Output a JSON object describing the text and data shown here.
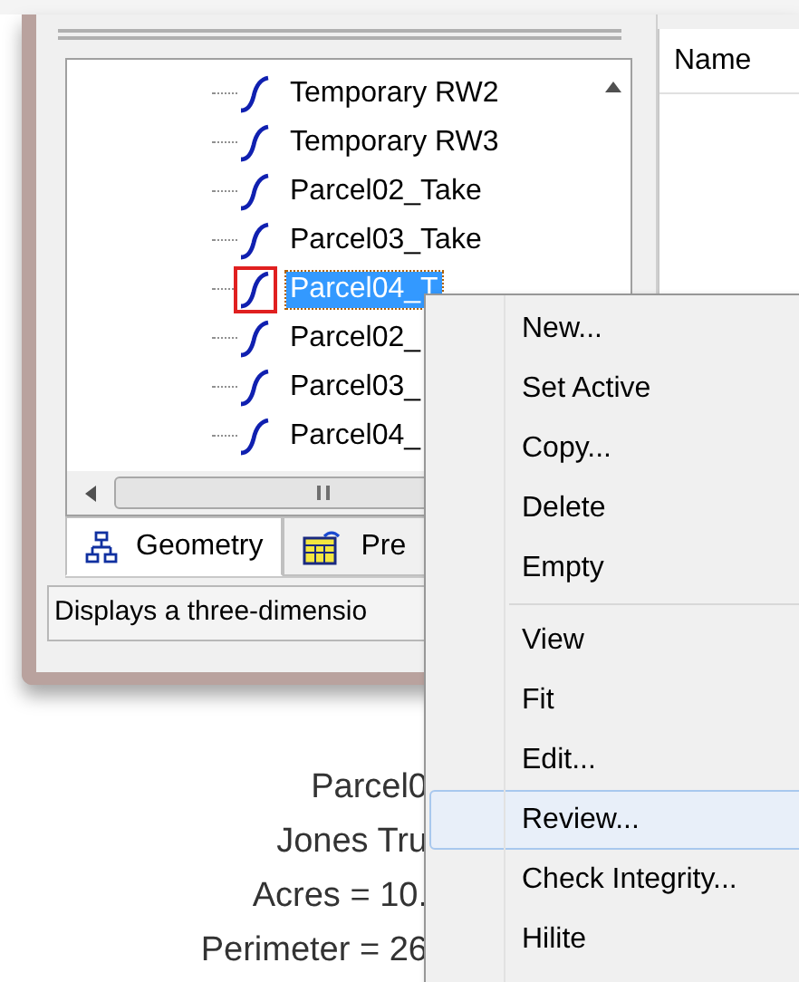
{
  "right_panel": {
    "column_header": "Name"
  },
  "tree": {
    "items": [
      {
        "label": "Temporary RW2",
        "selected": false
      },
      {
        "label": "Temporary RW3",
        "selected": false
      },
      {
        "label": "Parcel02_Take",
        "selected": false
      },
      {
        "label": "Parcel03_Take",
        "selected": false
      },
      {
        "label": "Parcel04_T",
        "selected": true
      },
      {
        "label": "Parcel02_",
        "selected": false
      },
      {
        "label": "Parcel03_",
        "selected": false
      },
      {
        "label": "Parcel04_",
        "selected": false
      }
    ]
  },
  "tabs": [
    {
      "label": "Geometry",
      "selected": true,
      "kind": "geometry"
    },
    {
      "label": "Pre",
      "selected": false,
      "kind": "table"
    }
  ],
  "status_bar": "Displays a three-dimensio",
  "document_lines": [
    "Parcel0",
    "Jones Tru",
    "Acres = 10.",
    "Perimeter = 26"
  ],
  "context_menu": {
    "items": [
      {
        "kind": "item",
        "label": "New...",
        "hovered": false
      },
      {
        "kind": "item",
        "label": "Set Active",
        "hovered": false
      },
      {
        "kind": "item",
        "label": "Copy...",
        "hovered": false
      },
      {
        "kind": "item",
        "label": "Delete",
        "hovered": false
      },
      {
        "kind": "item",
        "label": "Empty",
        "hovered": false
      },
      {
        "kind": "separator"
      },
      {
        "kind": "item",
        "label": "View",
        "hovered": false
      },
      {
        "kind": "item",
        "label": "Fit",
        "hovered": false
      },
      {
        "kind": "item",
        "label": "Edit...",
        "hovered": false
      },
      {
        "kind": "item",
        "label": "Review...",
        "hovered": true
      },
      {
        "kind": "item",
        "label": "Check Integrity...",
        "hovered": false
      },
      {
        "kind": "item",
        "label": "Hilite",
        "hovered": false
      }
    ]
  }
}
